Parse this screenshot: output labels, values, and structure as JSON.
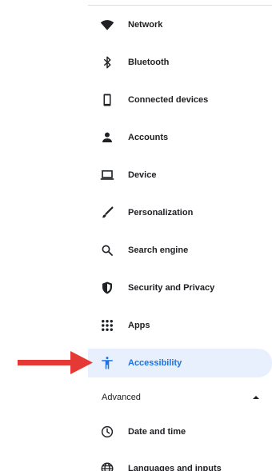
{
  "nav": {
    "items": [
      {
        "label": "Network",
        "icon": "wifi-icon"
      },
      {
        "label": "Bluetooth",
        "icon": "bluetooth-icon"
      },
      {
        "label": "Connected devices",
        "icon": "phone-icon"
      },
      {
        "label": "Accounts",
        "icon": "person-icon"
      },
      {
        "label": "Device",
        "icon": "laptop-icon"
      },
      {
        "label": "Personalization",
        "icon": "brush-icon"
      },
      {
        "label": "Search engine",
        "icon": "search-icon"
      },
      {
        "label": "Security and Privacy",
        "icon": "shield-icon"
      },
      {
        "label": "Apps",
        "icon": "apps-grid-icon"
      },
      {
        "label": "Accessibility",
        "icon": "accessibility-icon",
        "selected": true
      }
    ]
  },
  "advanced": {
    "label": "Advanced",
    "expanded": true,
    "items": [
      {
        "label": "Date and time",
        "icon": "clock-icon"
      },
      {
        "label": "Languages and inputs",
        "icon": "globe-icon"
      }
    ]
  },
  "colors": {
    "accent": "#1a73e8",
    "selected_bg": "#e8f0fe",
    "text": "#202124",
    "annotation_arrow": "#e53935"
  }
}
